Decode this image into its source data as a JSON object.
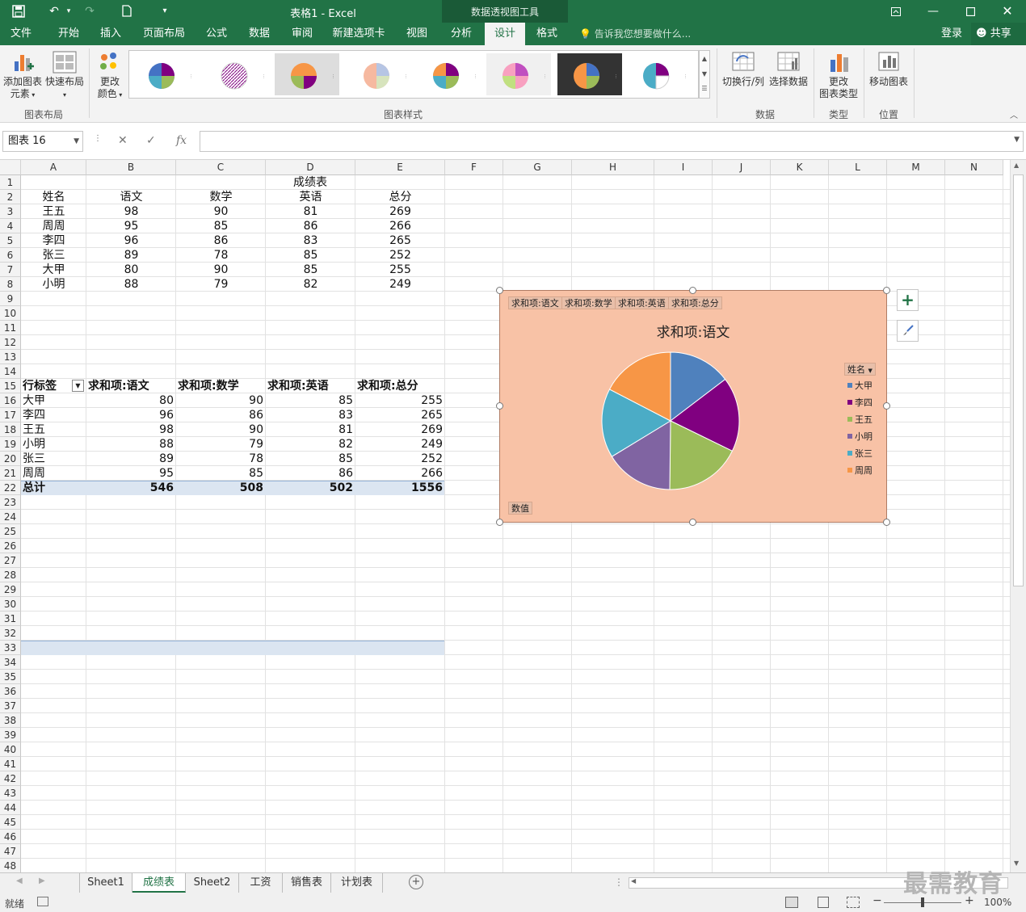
{
  "titlebar": {
    "window_title": "表格1 - Excel",
    "context_title": "数据透视图工具"
  },
  "tabs": [
    "文件",
    "开始",
    "插入",
    "页面布局",
    "公式",
    "数据",
    "审阅",
    "新建选项卡",
    "视图",
    "分析",
    "设计",
    "格式"
  ],
  "active_tab": "设计",
  "tellme": "告诉我您想要做什么...",
  "login": "登录",
  "share": "共享",
  "ribbon": {
    "add_element": "添加图表",
    "add_element2": "元素",
    "quick_layout": "快速布局",
    "change_colors": "更改",
    "change_colors2": "颜色",
    "group_layout": "图表布局",
    "group_styles": "图表样式",
    "switch_rowcol": "切换行/列",
    "select_data": "选择数据",
    "group_data": "数据",
    "change_type": "更改",
    "change_type2": "图表类型",
    "group_type": "类型",
    "move_chart": "移动图表",
    "group_location": "位置"
  },
  "namebox": "图表 16",
  "fx": "fx",
  "columns": [
    "A",
    "B",
    "C",
    "D",
    "E",
    "F",
    "G",
    "H",
    "I",
    "J",
    "K",
    "L",
    "M",
    "N"
  ],
  "sheet": {
    "title": "成绩表",
    "headers": [
      "姓名",
      "语文",
      "数学",
      "英语",
      "总分"
    ],
    "rows": [
      [
        "王五",
        "98",
        "90",
        "81",
        "269"
      ],
      [
        "周周",
        "95",
        "85",
        "86",
        "266"
      ],
      [
        "李四",
        "96",
        "86",
        "83",
        "265"
      ],
      [
        "张三",
        "89",
        "78",
        "85",
        "252"
      ],
      [
        "大甲",
        "80",
        "90",
        "85",
        "255"
      ],
      [
        "小明",
        "88",
        "79",
        "82",
        "249"
      ]
    ]
  },
  "pivot": {
    "headers": [
      "行标签",
      "求和项:语文",
      "求和项:数学",
      "求和项:英语",
      "求和项:总分"
    ],
    "rows": [
      [
        "大甲",
        "80",
        "90",
        "85",
        "255"
      ],
      [
        "李四",
        "96",
        "86",
        "83",
        "265"
      ],
      [
        "王五",
        "98",
        "90",
        "81",
        "269"
      ],
      [
        "小明",
        "88",
        "79",
        "82",
        "249"
      ],
      [
        "张三",
        "89",
        "78",
        "85",
        "252"
      ],
      [
        "周周",
        "95",
        "85",
        "86",
        "266"
      ]
    ],
    "total": [
      "总计",
      "546",
      "508",
      "502",
      "1556"
    ]
  },
  "chart": {
    "field_buttons": [
      "求和项:语文",
      "求和项:数学",
      "求和项:英语",
      "求和项:总分"
    ],
    "legend_field": "姓名",
    "axis_button": "数值",
    "bg": "#f8c2a6"
  },
  "chart_data": {
    "type": "pie",
    "title": "求和项:语文",
    "categories": [
      "大甲",
      "李四",
      "王五",
      "小明",
      "张三",
      "周周"
    ],
    "values": [
      80,
      96,
      98,
      88,
      89,
      95
    ],
    "colors": [
      "#4f81bd",
      "#800080",
      "#9bbb59",
      "#8064a2",
      "#4bacc6",
      "#f79646"
    ],
    "legend": "right"
  },
  "sheet_tabs": [
    "Sheet1",
    "成绩表",
    "Sheet2",
    "工资",
    "销售表",
    "计划表"
  ],
  "active_sheet": "成绩表",
  "status": {
    "ready": "就绪",
    "zoom": "100%"
  },
  "watermark": "最需教育"
}
